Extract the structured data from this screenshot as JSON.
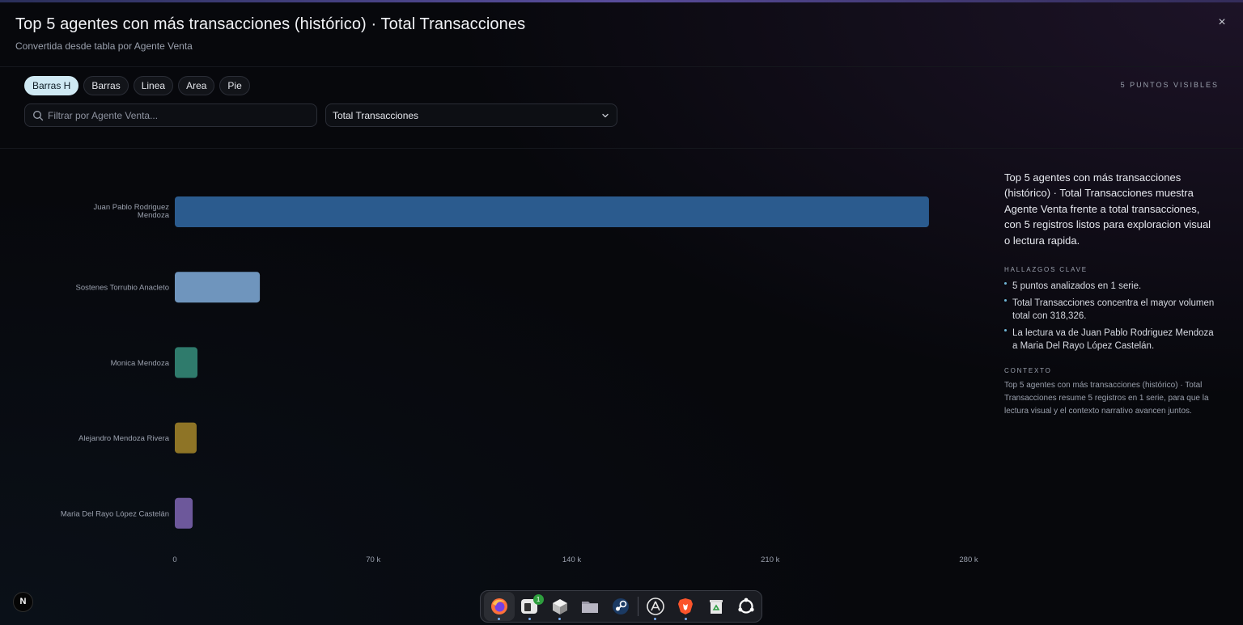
{
  "header": {
    "title": "Top 5 agentes con más transacciones (histórico) · Total Transacciones",
    "subtitle": "Convertida desde tabla por Agente Venta",
    "close_label": "×"
  },
  "chart_types": {
    "items": [
      {
        "label": "Barras H",
        "active": true
      },
      {
        "label": "Barras",
        "active": false
      },
      {
        "label": "Linea",
        "active": false
      },
      {
        "label": "Area",
        "active": false
      },
      {
        "label": "Pie",
        "active": false
      }
    ]
  },
  "visible_points": "5 PUNTOS VISIBLES",
  "filter": {
    "placeholder": "Filtrar por Agente Venta...",
    "value": "",
    "icon": "search-icon"
  },
  "metric_select": {
    "value": "Total Transacciones",
    "icon": "chevron-down-icon"
  },
  "chart_data": {
    "type": "bar",
    "orientation": "horizontal",
    "title": "",
    "xlabel": "",
    "ylabel": "",
    "categories": [
      "Juan Pablo Rodriguez Mendoza",
      "Sostenes Torrubio Anacleto",
      "Monica Mendoza",
      "Alejandro Mendoza Rivera",
      "Maria Del Rayo López Castelán"
    ],
    "values": [
      266000,
      30000,
      8000,
      7700,
      6300
    ],
    "colors": [
      "#2b5b8e",
      "#6f95bd",
      "#2f7b6c",
      "#8e7426",
      "#6d589b"
    ],
    "xlim": [
      0,
      280000
    ],
    "xticks": [
      "0",
      "70 k",
      "140 k",
      "210 k",
      "280 k"
    ],
    "tick_values": [
      0,
      70000,
      140000,
      210000,
      280000
    ],
    "grid": false,
    "legend": "none"
  },
  "side": {
    "lead": "Top 5 agentes con más transacciones (histórico) · Total Transacciones muestra Agente Venta frente a total transacciones, con 5 registros listos para exploracion visual o lectura rapida.",
    "findings_heading": "HALLAZGOS CLAVE",
    "findings": [
      "5 puntos analizados en 1 serie.",
      "Total Transacciones concentra el mayor volumen total con 318,326.",
      "La lectura va de Juan Pablo Rodriguez Mendoza a Maria Del Rayo López Castelán."
    ],
    "context_heading": "CONTEXTO",
    "context": "Top 5 agentes con más transacciones (histórico) · Total Transacciones resume 5 registros en 1 serie, para que la lectura visual y el contexto narrativo avancen juntos."
  },
  "badge": "N",
  "dock": {
    "apps": [
      {
        "name": "firefox-icon",
        "running": true,
        "active": true
      },
      {
        "name": "messaging-app-icon",
        "running": true,
        "notification": "1"
      },
      {
        "name": "package-box-icon",
        "running": true
      },
      {
        "name": "files-folder-icon",
        "running": false
      },
      {
        "name": "steam-icon",
        "running": false
      },
      {
        "name": "app-store-icon",
        "running": true
      },
      {
        "name": "brave-lion-icon",
        "running": true
      },
      {
        "name": "trash-recycle-icon",
        "running": false
      },
      {
        "name": "ubuntu-logo-icon",
        "running": false
      }
    ]
  }
}
